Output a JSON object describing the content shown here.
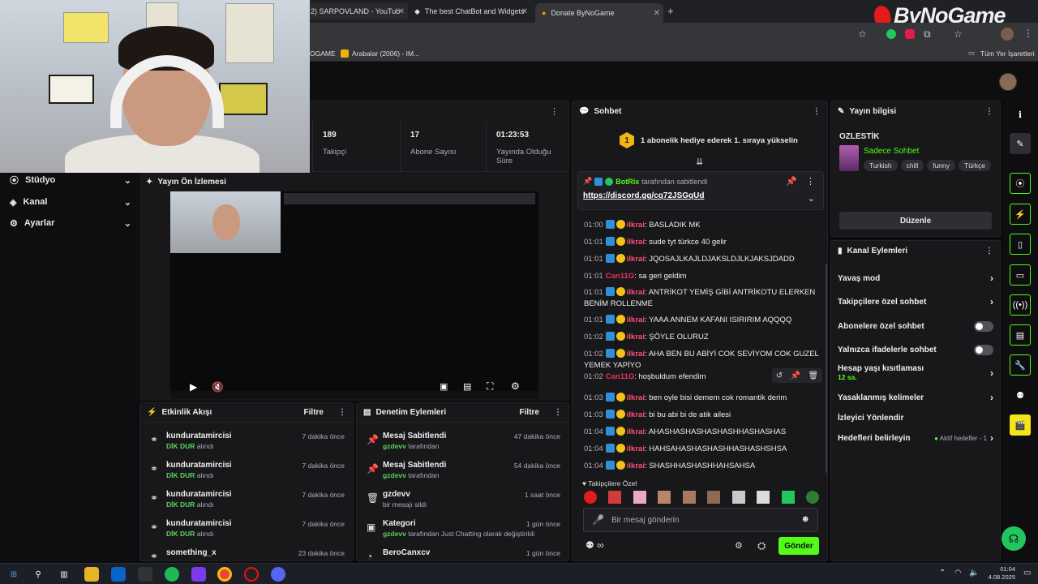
{
  "browser": {
    "tabs": [
      {
        "label": "2) SARPOVLAND - YouTub"
      },
      {
        "label": "The best ChatBot and Widgets"
      },
      {
        "label": "Donate ByNoGame"
      }
    ],
    "new_tab": "+",
    "bookmarks": [
      {
        "label": "OGAME"
      },
      {
        "label": "Arabalar (2006) - IM..."
      },
      {
        "label": "Tüm Yer İşaretleri"
      }
    ]
  },
  "brand": {
    "logo": "ByNoGame"
  },
  "sidebar": {
    "items": [
      {
        "label": "Stüdyo",
        "icon": "studio-icon"
      },
      {
        "label": "Kanal",
        "icon": "channel-icon"
      },
      {
        "label": "Ayarlar",
        "icon": "gear-icon"
      }
    ]
  },
  "stats": [
    {
      "value": "189",
      "label": "Takipçi"
    },
    {
      "value": "17",
      "label": "Abone Sayısı"
    },
    {
      "value": "01:23:53",
      "label": "Yayında Olduğu Süre"
    }
  ],
  "preview": {
    "title": "Yayın Ön İzlemesi"
  },
  "activity": {
    "title": "Etkinlik Akışı",
    "filter": "Filtre",
    "items": [
      {
        "user": "kunduratamircisi",
        "highlight": "DİK DUR",
        "action": "alındı",
        "time": "7 dakika önce"
      },
      {
        "user": "kunduratamircisi",
        "highlight": "DİK DUR",
        "action": "alındı",
        "time": "7 dakika önce"
      },
      {
        "user": "kunduratamircisi",
        "highlight": "DİK DUR",
        "action": "alındı",
        "time": "7 dakika önce"
      },
      {
        "user": "kunduratamircisi",
        "highlight": "DİK DUR",
        "action": "alındı",
        "time": "7 dakika önce"
      },
      {
        "user": "something_x",
        "highlight": "",
        "action": "",
        "time": "23 dakika önce"
      }
    ]
  },
  "moderation": {
    "title": "Denetim Eylemleri",
    "filter": "Filtre",
    "items": [
      {
        "title": "Mesaj Sabitlendi",
        "user": "gzdevv",
        "detail": "tarafından",
        "time": "47 dakika önce"
      },
      {
        "title": "Mesaj Sabitlendi",
        "user": "gzdevv",
        "detail": "tarafından",
        "time": "54 dakika önce"
      },
      {
        "title": "gzdevv",
        "user": "",
        "detail": "bir mesajı sildi",
        "time": "1 saat önce"
      },
      {
        "title": "Kategori",
        "user": "gzdevv",
        "detail": "tarafından Just Chatting olarak değiştirildi",
        "time": "1 gün önce"
      },
      {
        "title": "BeroCanxcv",
        "user": "",
        "detail": "",
        "time": "1 gün önce"
      }
    ]
  },
  "chat": {
    "title": "Sohbet",
    "gift_banner": "1 abonelik hediye ederek 1. sıraya yükselin",
    "gift_rank": "1",
    "pinned": {
      "user": "BotRix",
      "by": "tarafından sabitlendi",
      "link": "https://discord.gg/cq72JSGqUd"
    },
    "messages": [
      {
        "ts": "01:00",
        "user": "ilkrai",
        "text": ": BASLADIK MK"
      },
      {
        "ts": "01:01",
        "user": "ilkrai",
        "text": ": sude tyt türkce 40 gelir"
      },
      {
        "ts": "01:01",
        "user": "ilkrai",
        "text": ": JQOSAJLKAJLDJAKSLDJLKJAKSJDADD"
      },
      {
        "ts": "01:01",
        "user": "Can11G",
        "text": ": sa geri geldim"
      },
      {
        "ts": "01:01",
        "user": "ilkrai",
        "text": ": ANTRİKOT YEMİŞ GİBİ ANTRİKOTU ELERKEN BENİM ROLLENME"
      },
      {
        "ts": "01:01",
        "user": "ilkrai",
        "text": ": YAAA ANNEM KAFANI ISIRIRIM AQQQQ"
      },
      {
        "ts": "01:02",
        "user": "ilkrai",
        "text": ": ŞÖYLE OLURUZ"
      },
      {
        "ts": "01:02",
        "user": "ilkrai",
        "text": ": AHA BEN BU ABİYİ COK SEVİYOM COK GUZEL YEMEK YAPİYO"
      },
      {
        "ts": "01:02",
        "user": "Can11G",
        "text": ": hoşbuldum efendim"
      },
      {
        "ts": "01:03",
        "user": "ilkrai",
        "text": ": ben oyle bisi demem cok romantik derim"
      },
      {
        "ts": "01:03",
        "user": "ilkrai",
        "text": ": bi bu abi bi de atik ailesi"
      },
      {
        "ts": "01:04",
        "user": "ilkrai",
        "text": ": AHASHASHASHASHASHHASHASHAS"
      },
      {
        "ts": "01:04",
        "user": "ilkrai",
        "text": ": HAHSAHASHASHASHHASHASHSHSA"
      },
      {
        "ts": "01:04",
        "user": "ilkrai",
        "text": ": SHASHHASHASHHAHSAHSA"
      }
    ],
    "followers_label": "Takipçilere Özel",
    "input_placeholder": "Bir mesaj gönderin",
    "send": "Gönder",
    "infinity": "∞"
  },
  "stream_info": {
    "title": "Yayın bilgisi",
    "stream_title": "OZLESTİK",
    "category": "Sadece Sohbet",
    "tags": [
      "Turkish",
      "chill",
      "funny",
      "Türkçe"
    ],
    "edit": "Düzenle"
  },
  "channel_actions": {
    "title": "Kanal Eylemleri",
    "items": [
      {
        "label": "Yavaş mod",
        "type": "arrow"
      },
      {
        "label": "Takipçilere özel sohbet",
        "type": "arrow"
      },
      {
        "label": "Abonelere özel sohbet",
        "type": "toggle"
      },
      {
        "label": "Yalnızca ifadelerle sohbet",
        "type": "toggle"
      },
      {
        "label": "Hesap yaşı kısıtlaması",
        "sub": "12 sa.",
        "type": "arrow"
      },
      {
        "label": "Yasaklanmış kelimeler",
        "type": "arrow"
      },
      {
        "label": "İzleyici Yönlendir",
        "type": "none"
      },
      {
        "label": "Hedefleri belirleyin",
        "sub": "Aktif hedefler - 1",
        "type": "arrow"
      }
    ]
  },
  "taskbar": {
    "time": "01:04",
    "date": "4.08.2025"
  },
  "colors": {
    "accent": "#53fc18",
    "bg": "#0e0e10",
    "panel": "#18181b",
    "user_red": "#ff4f74"
  }
}
